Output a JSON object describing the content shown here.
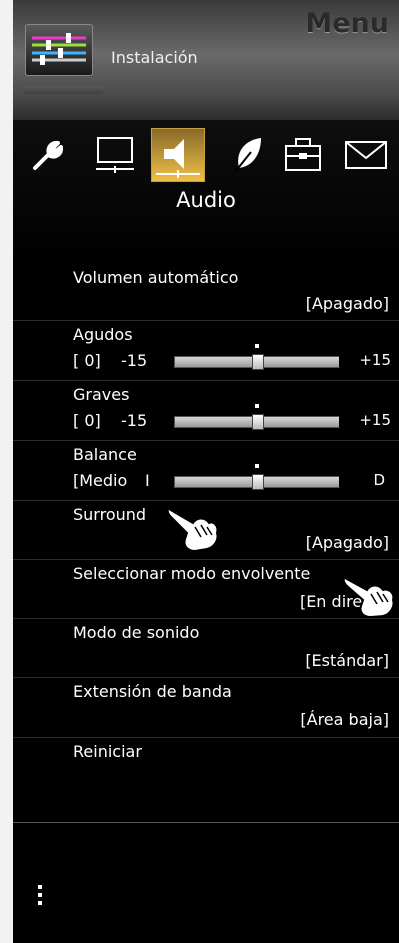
{
  "header": {
    "title": "Menu",
    "subtitle": "Instalación",
    "icon": "settings-sliders-icon"
  },
  "categories": [
    {
      "name": "wrench",
      "icon": "wrench-icon"
    },
    {
      "name": "display",
      "icon": "monitor-icon"
    },
    {
      "name": "audio",
      "icon": "speaker-icon",
      "selected": true
    },
    {
      "name": "eco",
      "icon": "leaf-icon"
    },
    {
      "name": "tools",
      "icon": "toolbox-icon"
    },
    {
      "name": "mail",
      "icon": "envelope-icon"
    }
  ],
  "selected_category_label": "Audio",
  "accent_color": "#f0c048",
  "menu": {
    "volumen": {
      "label": "Volumen automático",
      "value": "[Apagado]"
    },
    "agudos": {
      "label": "Agudos",
      "value_text": "[    0]",
      "min": "-15",
      "max": "+15",
      "value": 0,
      "range": [
        -15,
        15
      ]
    },
    "graves": {
      "label": "Graves",
      "value_text": "[    0]",
      "min": "-15",
      "max": "+15",
      "value": 0,
      "range": [
        -15,
        15
      ]
    },
    "balance": {
      "label": "Balance",
      "value_text": "[Medio",
      "min": "I",
      "max": "D",
      "value": 0,
      "range": [
        -15,
        15
      ]
    },
    "surround": {
      "label": "Surround",
      "value": "[Apagado]"
    },
    "modo_env": {
      "label": "Seleccionar modo envolvente",
      "value": "[En direc"
    },
    "modo_sonido": {
      "label": "Modo de sonido",
      "value": "[Estándar]"
    },
    "extension": {
      "label": "Extensión de banda",
      "value": "[Área baja]"
    },
    "reiniciar": {
      "label": "Reiniciar"
    }
  },
  "footer": {
    "icon": "more-vertical-icon"
  }
}
